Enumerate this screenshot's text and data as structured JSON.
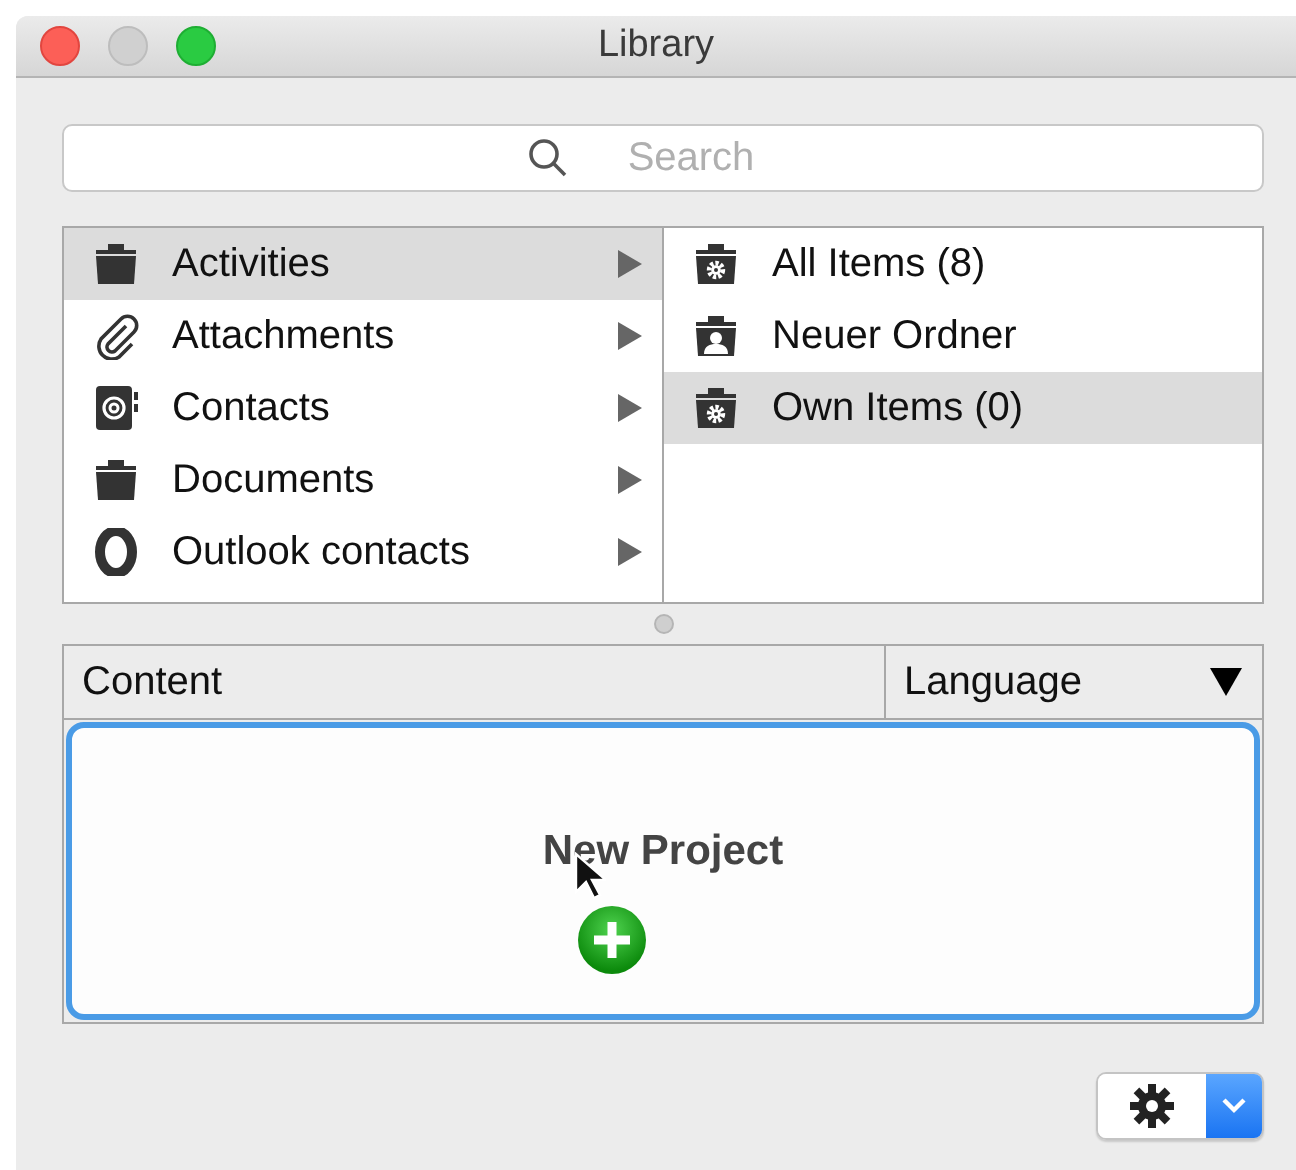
{
  "window": {
    "title": "Library"
  },
  "search": {
    "placeholder": "Search"
  },
  "categories": [
    {
      "label": "Activities",
      "kind": "folder",
      "selected": true
    },
    {
      "label": "Attachments",
      "kind": "paperclip",
      "selected": false
    },
    {
      "label": "Contacts",
      "kind": "address-book",
      "selected": false
    },
    {
      "label": "Documents",
      "kind": "folder",
      "selected": false
    },
    {
      "label": "Outlook contacts",
      "kind": "ring",
      "selected": false
    }
  ],
  "folders": [
    {
      "label": "All Items (8)",
      "kind": "gear-folder",
      "selected": false
    },
    {
      "label": "Neuer Ordner",
      "kind": "person-folder",
      "selected": false
    },
    {
      "label": "Own Items (0)",
      "kind": "gear-folder",
      "selected": true
    }
  ],
  "table": {
    "columns": [
      {
        "label": "Content"
      },
      {
        "label": "Language",
        "sortable": true
      }
    ],
    "drop_hint": "New Project"
  }
}
